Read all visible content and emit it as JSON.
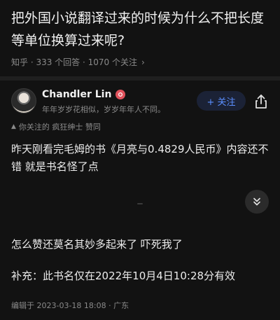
{
  "question": {
    "title": "把外国小说翻译过来的时候为什么不把长度等单位换算过来呢?",
    "meta": "知乎 · 333 个回答 · 1070 个关注",
    "chevron_icon": "chevron-right-icon"
  },
  "author": {
    "name": "Chandler Lin",
    "bio": "年年岁岁花相似，岁岁年年人不同。",
    "badge_icon": "verified-badge-icon",
    "follow_label": "+ 关注",
    "share_icon": "share-icon"
  },
  "liked_by": "你关注的 疯狂绅士 赞同",
  "answer": {
    "p1": "昨天刚看完毛姆的书《月亮与0.4829人民币》内容还不错 就是书名怪了点",
    "p2": "怎么赞还莫名其妙多起来了 吓死我了",
    "p3": "补充：此书名仅在2022年10月4日10:28分有效"
  },
  "edit_info": "编辑于 2023-03-18 18:08 · 广东",
  "colors": {
    "background": "#121212",
    "accent": "#5b8fff",
    "badge": "#e0525c"
  }
}
